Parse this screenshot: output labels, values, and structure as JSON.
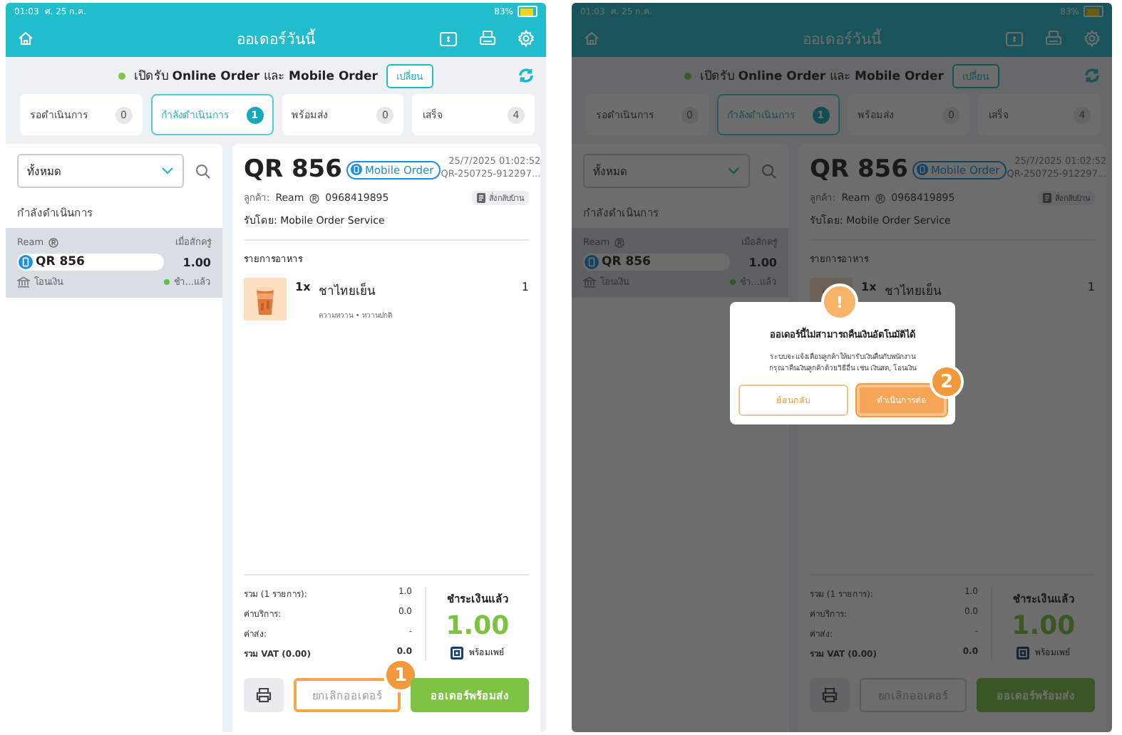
{
  "screens": [
    {
      "status_bar": {
        "time": "01:03",
        "date": "ศ. 25 ก.ค.",
        "battery": "83%"
      },
      "title": "ออเดอร์วันนี้",
      "banner": {
        "text": "เปิดรับ **Online Order** และ **Mobile Order**",
        "button": "เปลี่ยน"
      },
      "tabs": [
        {
          "label": "รอดำเนินการ",
          "count": "0",
          "selected": false
        },
        {
          "label": "กำลังดำเนินการ",
          "count": "1",
          "selected": true
        },
        {
          "label": "พร้อมส่ง",
          "count": "0",
          "selected": false
        },
        {
          "label": "เสร็จ",
          "count": "4",
          "selected": false
        }
      ],
      "filter": {
        "value": "ทั้งหมด"
      },
      "list_heading": "กำลังดำเนินการ",
      "orders": [
        {
          "customer": "Ream",
          "time": "เมื่อสักครู่",
          "number": "QR 856",
          "amount": "1.00",
          "payment": "โอนเงิน",
          "status": "ชำ...แล้ว",
          "selected": true
        }
      ],
      "detail": {
        "number": "QR 856",
        "channel": "Mobile Order",
        "datetime": "25/7/2025 01:02:52",
        "order_id": "QR-250725-912297...",
        "customer_label": "ลูกค้า:",
        "customer": "Ream",
        "phone": "0968419895",
        "service": "สั่งกลับบ้าน",
        "received_by": "รับโดย: Mobile Order Service",
        "items_heading": "รายการอาหาร",
        "items": [
          {
            "qty": "1x",
            "name": "ชาไทยเย็น",
            "options": "ความหวาน • หวานปกติ",
            "count": "1"
          }
        ],
        "summary": [
          {
            "label": "รวม (1 รายการ):",
            "value": "1.0",
            "bold": false
          },
          {
            "label": "ค่าบริการ:",
            "value": "0.0",
            "bold": false
          },
          {
            "label": "ค่าส่ง:",
            "value": "-",
            "bold": false
          },
          {
            "label": "รวม VAT (0.00)",
            "value": "0.0",
            "bold": true
          }
        ],
        "payment": {
          "status": "ชำระเงินแล้ว",
          "amount": "1.00",
          "method": "พร้อมเพย์"
        }
      },
      "actions": {
        "cancel": {
          "label": "ยกเลิกออเดอร์",
          "highlighted": true,
          "callout": "1"
        },
        "ready": {
          "label": "ออเดอร์พร้อมส่ง"
        }
      }
    },
    {
      "status_bar": {
        "time": "01:03",
        "date": "ศ. 25 ก.ค.",
        "battery": "83%"
      },
      "title": "ออเดอร์วันนี้",
      "banner": {
        "text": "เปิดรับ **Online Order** และ **Mobile Order**",
        "button": "เปลี่ยน"
      },
      "tabs": [
        {
          "label": "รอดำเนินการ",
          "count": "0",
          "selected": false
        },
        {
          "label": "กำลังดำเนินการ",
          "count": "1",
          "selected": true
        },
        {
          "label": "พร้อมส่ง",
          "count": "0",
          "selected": false
        },
        {
          "label": "เสร็จ",
          "count": "4",
          "selected": false
        }
      ],
      "filter": {
        "value": "ทั้งหมด"
      },
      "list_heading": "กำลังดำเนินการ",
      "orders": [
        {
          "customer": "Ream",
          "time": "เมื่อสักครู่",
          "number": "QR 856",
          "amount": "1.00",
          "payment": "โอนเงิน",
          "status": "ชำ...แล้ว",
          "selected": true
        }
      ],
      "detail": {
        "number": "QR 856",
        "channel": "Mobile Order",
        "datetime": "25/7/2025 01:02:52",
        "order_id": "QR-250725-912297...",
        "customer_label": "ลูกค้า:",
        "customer": "Ream",
        "phone": "0968419895",
        "service": "สั่งกลับบ้าน",
        "received_by": "รับโดย: Mobile Order Service",
        "items_heading": "รายการอาหาร",
        "items": [
          {
            "qty": "1x",
            "name": "ชาไทยเย็น",
            "count": "1"
          }
        ],
        "summary": [
          {
            "label": "รวม (1 รายการ):",
            "value": "1.0",
            "bold": false
          },
          {
            "label": "ค่าบริการ:",
            "value": "0.0",
            "bold": false
          },
          {
            "label": "ค่าส่ง:",
            "value": "-",
            "bold": false
          },
          {
            "label": "รวม VAT (0.00)",
            "value": "0.0",
            "bold": true
          }
        ],
        "payment": {
          "status": "ชำระเงินแล้ว",
          "amount": "1.00",
          "method": "พร้อมเพย์"
        }
      },
      "actions": {
        "cancel": {
          "label": "ยกเลิกออเดอร์",
          "highlighted": false
        },
        "ready": {
          "label": "ออเดอร์พร้อมส่ง"
        }
      },
      "dialog": {
        "icon": "!",
        "title": "ออเดอร์นี้ไม่สามารถคืนเงินอัตโนมัติได้",
        "message": [
          "ระบบจะแจ้งเตือนลูกค้าให้มารับเงินคืนกับพนักงาน",
          "กรุณาคืนเงินลูกค้าด้วยวิธีอื่น เช่น เงินสด, โอนเงิน"
        ],
        "back": {
          "label": "ย้อนกลับ"
        },
        "confirm": {
          "label": "ดำเนินการต่อ",
          "highlighted": true,
          "callout": "2"
        }
      }
    }
  ]
}
